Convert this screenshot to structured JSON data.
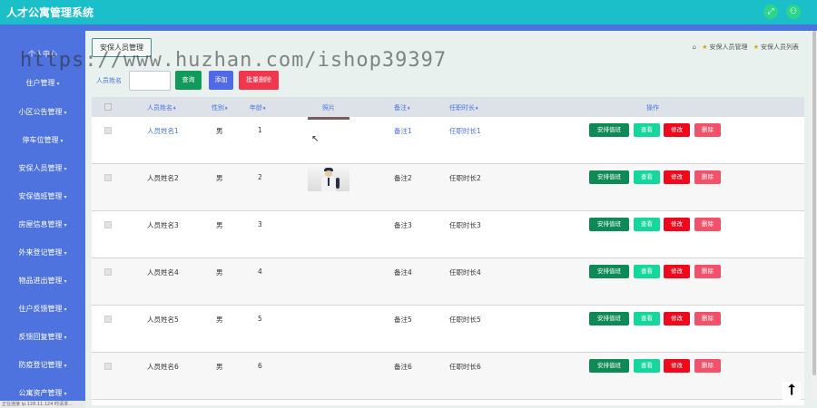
{
  "app": {
    "title": "人才公寓管理系统",
    "header_buttons": [
      "fullscreen-icon",
      "user-icon"
    ]
  },
  "sidebar": {
    "items": [
      {
        "label": "个人中心",
        "caret": ""
      },
      {
        "label": "住户管理",
        "caret": "▾"
      },
      {
        "label": "小区公告管理",
        "caret": "▾"
      },
      {
        "label": "停车位管理",
        "caret": "▾"
      },
      {
        "label": "安保人员管理",
        "caret": "▾"
      },
      {
        "label": "安保值班管理",
        "caret": "▾"
      },
      {
        "label": "房屋信息管理",
        "caret": "▾"
      },
      {
        "label": "外来登记管理",
        "caret": "▾"
      },
      {
        "label": "物品进出管理",
        "caret": "▾"
      },
      {
        "label": "住户反馈管理",
        "caret": "▾"
      },
      {
        "label": "反馈回复管理",
        "caret": "▾"
      },
      {
        "label": "防疫登记管理",
        "caret": "▾"
      },
      {
        "label": "公寓资产管理",
        "caret": "▾"
      }
    ]
  },
  "statusbar": {
    "text": "正在连接 ip.128.11.124 时请求..."
  },
  "main": {
    "tab_title": "安保人员管理",
    "breadcrumb": [
      "安保人员管理",
      "安保人员列表"
    ],
    "search": {
      "label": "人员姓名",
      "value": "",
      "placeholder": ""
    },
    "buttons": {
      "query": "查询",
      "add": "添加",
      "batch_delete": "批量删除"
    }
  },
  "table": {
    "headers": [
      "人员姓名",
      "性别",
      "年龄",
      "照片",
      "备注",
      "任职时长",
      "操作"
    ],
    "sortable": [
      true,
      true,
      true,
      false,
      true,
      true,
      false
    ],
    "rows": [
      {
        "name": "人员姓名1",
        "gender": "男",
        "age": "1",
        "note": "备注1",
        "tenure": "任职时长1"
      },
      {
        "name": "人员姓名2",
        "gender": "男",
        "age": "2",
        "note": "备注2",
        "tenure": "任职时长2"
      },
      {
        "name": "人员姓名3",
        "gender": "男",
        "age": "3",
        "note": "备注3",
        "tenure": "任职时长3"
      },
      {
        "name": "人员姓名4",
        "gender": "男",
        "age": "4",
        "note": "备注4",
        "tenure": "任职时长4"
      },
      {
        "name": "人员姓名5",
        "gender": "男",
        "age": "5",
        "note": "备注5",
        "tenure": "任职时长5"
      },
      {
        "name": "人员姓名6",
        "gender": "男",
        "age": "6",
        "note": "备注6",
        "tenure": "任职时长6"
      }
    ],
    "actions": {
      "arrange": "安排值班",
      "view": "查看",
      "edit": "修改",
      "delete": "删除"
    }
  },
  "watermark": "https://www.huzhan.com/ishop39397",
  "colors": {
    "topbar": "#1bbfc9",
    "sidebar": "#4e73df",
    "query": "#119a5a",
    "add": "#5069e6",
    "danger": "#f0374e"
  }
}
